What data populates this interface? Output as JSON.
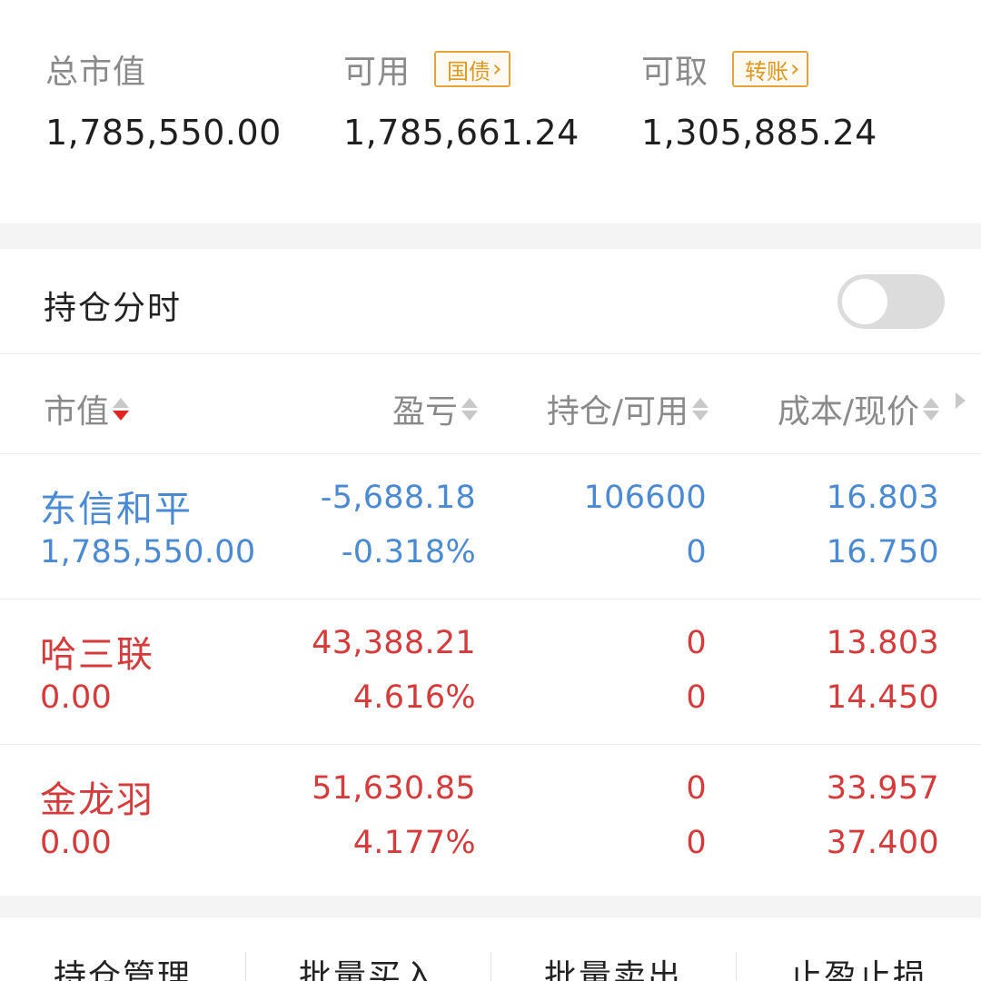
{
  "summary": {
    "total_market_value": {
      "label": "总市值",
      "value": "1,785,550.00"
    },
    "available": {
      "label": "可用",
      "tag": "国债",
      "value": "1,785,661.24"
    },
    "withdrawable": {
      "label": "可取",
      "tag": "转账",
      "value": "1,305,885.24"
    }
  },
  "intraday": {
    "label": "持仓分时",
    "enabled": false
  },
  "table": {
    "headers": {
      "market_value": "市值",
      "profit_loss": "盈亏",
      "position_available": "持仓/可用",
      "cost_price": "成本/现价"
    },
    "rows": [
      {
        "name": "东信和平",
        "market_value": "1,785,550.00",
        "profit_loss": "-5,688.18",
        "profit_loss_pct": "-0.318%",
        "position": "106600",
        "available": "0",
        "cost": "16.803",
        "price": "16.750",
        "trend": "down",
        "color": "#4a8ad4"
      },
      {
        "name": "哈三联",
        "market_value": "0.00",
        "profit_loss": "43,388.21",
        "profit_loss_pct": "4.616%",
        "position": "0",
        "available": "0",
        "cost": "13.803",
        "price": "14.450",
        "trend": "up",
        "color": "#d63a3a"
      },
      {
        "name": "金龙羽",
        "market_value": "0.00",
        "profit_loss": "51,630.85",
        "profit_loss_pct": "4.177%",
        "position": "0",
        "available": "0",
        "cost": "33.957",
        "price": "37.400",
        "trend": "up",
        "color": "#d63a3a"
      }
    ]
  },
  "bottom_actions": [
    "持仓管理",
    "批量买入",
    "批量卖出",
    "止盈止损"
  ],
  "colors": {
    "accent_tag": "#e0961f",
    "loss_blue": "#4a8ad4",
    "gain_red": "#d63a3a",
    "sort_active": "#e02424"
  }
}
